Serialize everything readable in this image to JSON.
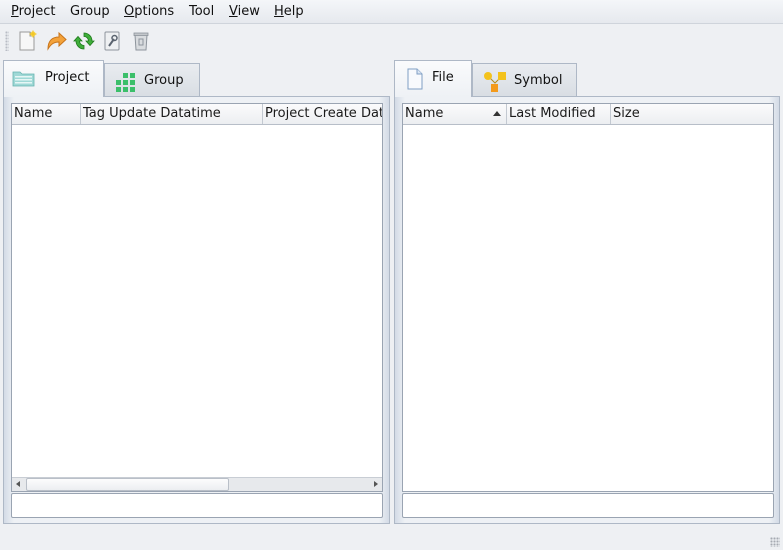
{
  "menubar": {
    "items": [
      {
        "mnemonic": "P",
        "rest": "roject"
      },
      {
        "mnemonic": "",
        "rest": "Group"
      },
      {
        "mnemonic": "O",
        "rest": "ptions"
      },
      {
        "mnemonic": "",
        "rest": "Tool"
      },
      {
        "mnemonic": "V",
        "rest": "iew"
      },
      {
        "mnemonic": "H",
        "rest": "elp"
      }
    ]
  },
  "toolbar": {
    "icons": [
      "new-document-icon",
      "redo-arrow-icon",
      "refresh-icon",
      "properties-wrench-icon",
      "trash-icon"
    ]
  },
  "left_pane": {
    "tabs": [
      {
        "label": "Project",
        "icon": "folder-icon",
        "active": true
      },
      {
        "label": "Group",
        "icon": "grid-icon",
        "active": false
      }
    ],
    "columns": [
      "Name",
      "Tag Update Datatime",
      "Project Create Dat"
    ],
    "rows": [],
    "input_value": ""
  },
  "right_pane": {
    "tabs": [
      {
        "label": "File",
        "icon": "file-icon",
        "active": true
      },
      {
        "label": "Symbol",
        "icon": "symbol-icon",
        "active": false
      }
    ],
    "columns": [
      "Name",
      "Last Modified",
      "Size"
    ],
    "sorted_column": "Name",
    "sort_direction": "ascending",
    "rows": [],
    "input_value": ""
  },
  "colors": {
    "menubar_bg": "#e9ecf0",
    "pane_border": "#aeb8c6",
    "list_bg": "#ffffff"
  }
}
